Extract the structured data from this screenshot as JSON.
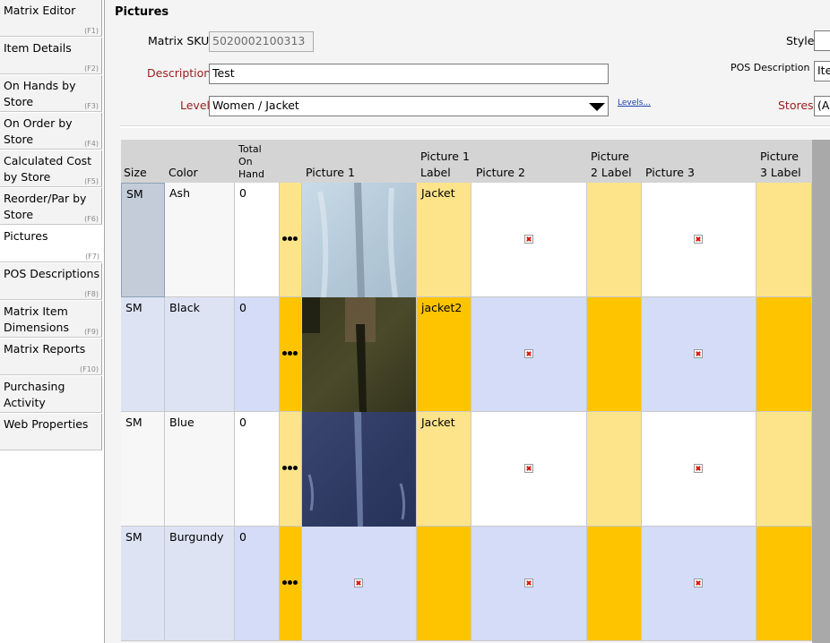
{
  "sidebar": {
    "items": [
      {
        "label": "Matrix Editor",
        "key": "(F1)"
      },
      {
        "label": "Item Details",
        "key": "(F2)"
      },
      {
        "label": "On Hands by Store",
        "key": "(F3)"
      },
      {
        "label": "On Order by Store",
        "key": "(F4)"
      },
      {
        "label": "Calculated Cost by Store",
        "key": "(F5)"
      },
      {
        "label": "Reorder/Par by Store",
        "key": "(F6)"
      },
      {
        "label": "Pictures",
        "key": "(F7)"
      },
      {
        "label": "POS Descriptions",
        "key": "(F8)"
      },
      {
        "label": "Matrix Item Dimensions",
        "key": "(F9)"
      },
      {
        "label": "Matrix Reports",
        "key": "(F10)"
      },
      {
        "label": "Purchasing Activity",
        "key": ""
      },
      {
        "label": "Web Properties",
        "key": ""
      }
    ],
    "active_index": 6
  },
  "header": {
    "title": "Pictures",
    "matrix_sku_label": "Matrix SKU",
    "matrix_sku_value": "5020002100313",
    "description_label": "Description",
    "description_value": "Test",
    "level_label": "Level",
    "level_value": "Women / Jacket",
    "levels_link": "Levels...",
    "style_label": "Style",
    "style_value": "",
    "pos_desc_label": "POS Description 1",
    "pos_desc_value": "Ite",
    "stores_label": "Stores",
    "stores_value": "(A"
  },
  "grid": {
    "columns": {
      "size": "Size",
      "color": "Color",
      "total_on_hand": [
        "Total",
        "On",
        "Hand"
      ],
      "picture1": "Picture 1",
      "picture1_label": [
        "Picture 1",
        "Label"
      ],
      "picture2": "Picture 2",
      "picture2_label": [
        "Picture",
        "2 Label"
      ],
      "picture3": "Picture 3",
      "picture3_label": [
        "Picture",
        "3 Label"
      ]
    },
    "rows": [
      {
        "size": "SM",
        "color": "Ash",
        "on_hand": "0",
        "pic1": "light-jacket-photo",
        "pic1_label": "Jacket"
      },
      {
        "size": "SM",
        "color": "Black",
        "on_hand": "0",
        "pic1": "dark-jacket-photo",
        "pic1_label": "jacket2"
      },
      {
        "size": "SM",
        "color": "Blue",
        "on_hand": "0",
        "pic1": "blue-jacket-photo",
        "pic1_label": "Jacket"
      },
      {
        "size": "SM",
        "color": "Burgundy",
        "on_hand": "0",
        "pic1": "broken-image-icon",
        "pic1_label": ""
      }
    ]
  },
  "colors": {
    "row_even_bg": "#ffffff",
    "row_odd_bg": "#d4dcf7",
    "label_light": "#fde48a",
    "label_dark": "#fec400",
    "selected_cell": "#c3ccd8"
  }
}
